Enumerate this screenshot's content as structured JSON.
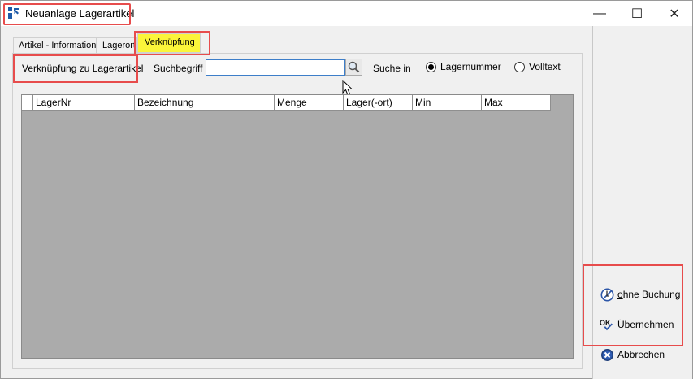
{
  "window": {
    "title": "Neuanlage Lagerartikel",
    "controls": {
      "minimize": "—",
      "maximize": "☐",
      "close": "✕"
    }
  },
  "tabs": [
    {
      "label": "Artikel - Information",
      "active": false
    },
    {
      "label": "Lagerort",
      "active": false
    },
    {
      "label": "Verknüpfung",
      "active": true
    }
  ],
  "section": {
    "label": "Verknüpfung zu Lagerartikel"
  },
  "search": {
    "label": "Suchbegriff",
    "value": "",
    "suche_in_label": "Suche in",
    "options": [
      {
        "label": "Lagernummer",
        "checked": true
      },
      {
        "label": "Volltext",
        "checked": false
      }
    ]
  },
  "grid": {
    "columns": [
      "LagerNr",
      "Bezeichnung",
      "Menge",
      "Lager(-ort)",
      "Min",
      "Max"
    ],
    "rows": []
  },
  "buttons": {
    "ohne_buchung": {
      "accel": "o",
      "rest": "hne Buchung"
    },
    "uebernehmen": {
      "accel": "Ü",
      "rest": "bernehmen"
    },
    "abbrechen": {
      "accel": "A",
      "rest": "bbrechen"
    }
  },
  "colors": {
    "highlight_border": "#e74c4c",
    "active_tab": "#fbf53a",
    "grid_background": "#ababab",
    "input_border": "#3d7ec9"
  }
}
